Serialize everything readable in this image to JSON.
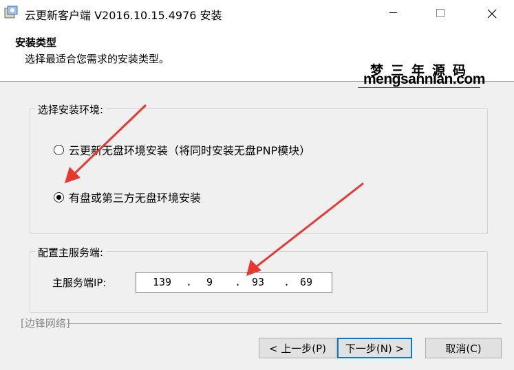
{
  "window": {
    "title": "云更新客户端 V2016.10.15.4976 安装"
  },
  "header": {
    "title": "安装类型",
    "subtitle": "选择最适合您需求的安装类型。"
  },
  "watermark": {
    "line1": "梦三年源码",
    "line2": "mengsannian.com"
  },
  "install_env": {
    "legend": "选择安装环境:",
    "options": [
      {
        "label": "云更新无盘环境安装（将同时安装无盘PNP模块）",
        "checked": false
      },
      {
        "label": "有盘或第三方无盘环境安装",
        "checked": true
      }
    ]
  },
  "server": {
    "legend": "配置主服务端:",
    "ip_label": "主服务端IP:",
    "ip_octets": [
      "139",
      "9",
      "93",
      "69"
    ]
  },
  "footer": {
    "brand": "[边锋网络]"
  },
  "buttons": {
    "back": "< 上一步(P)",
    "next": "下一步(N) >",
    "cancel": "取消(C)"
  },
  "colors": {
    "accent": "#0078d7",
    "arrow": "#e8372f"
  }
}
